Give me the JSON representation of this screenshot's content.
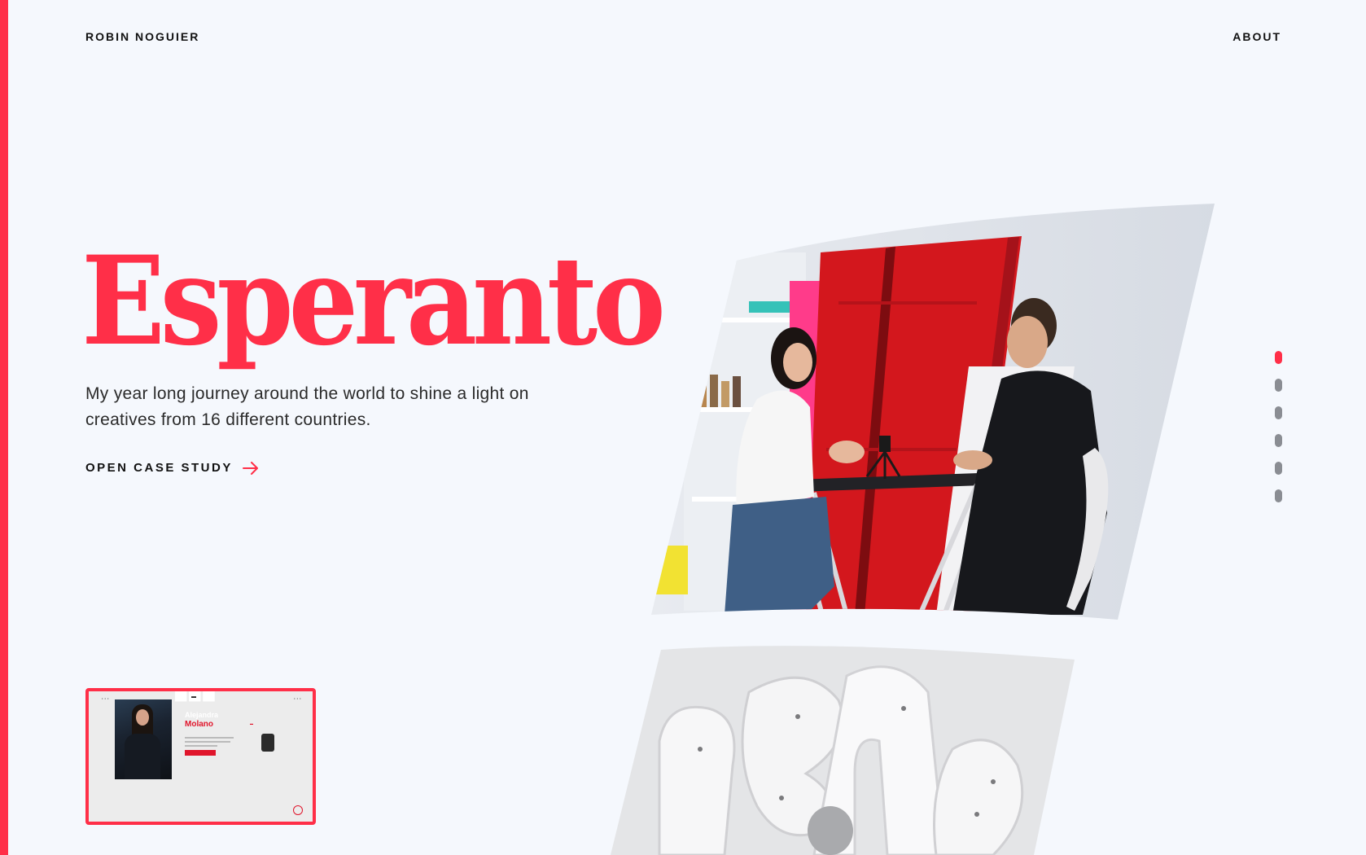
{
  "header": {
    "brand": "ROBIN NOGUIER",
    "nav_about": "ABOUT"
  },
  "hero": {
    "title": "Esperanto",
    "subtitle": "My year long journey around the world to shine a light on creatives from 16 different countries.",
    "cta_label": "OPEN CASE STUDY",
    "cta_icon": "arrow-right-icon"
  },
  "slider": {
    "count": 6,
    "active_index": 0
  },
  "preview_card": {
    "first_name": "Alejandra",
    "last_name": "Molano"
  },
  "colors": {
    "accent": "#ff2f48",
    "background": "#f5f8fd",
    "text": "#111111",
    "dot_inactive": "#8a8d93"
  }
}
